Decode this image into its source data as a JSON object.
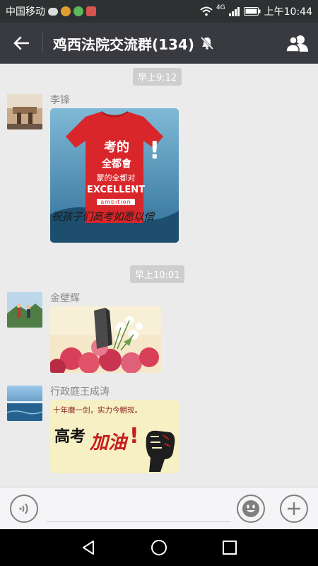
{
  "status_bar": {
    "carrier": "中国移动",
    "network": "4G",
    "time": "上午10:44"
  },
  "header": {
    "title": "鸡西法院交流群(134)",
    "back_icon": "arrow-left-icon",
    "mute_icon": "bell-muted-icon",
    "members_icon": "group-members-icon"
  },
  "messages": {
    "time1": "早上9:12",
    "time2": "早上10:01",
    "m1": {
      "sender": "李锋",
      "image": {
        "line1": "考的",
        "line2": "全都會",
        "line3": "蒙的全都对",
        "line4": "EXCELLENT",
        "line5": "ambition",
        "line6": "祝孩子们高考如愿以偿"
      }
    },
    "m2": {
      "sender": "金壁辉"
    },
    "m3": {
      "sender": "行政庭王成涛",
      "image": {
        "top": "十年磨一剑，实力今朝现。",
        "word1": "高考",
        "word2": "加油",
        "mark": "!"
      }
    }
  },
  "input_bar": {
    "voice_icon": "voice-icon",
    "emoji_icon": "emoji-icon",
    "plus_icon": "plus-icon"
  },
  "colors": {
    "title_bar": "#393a3f",
    "status_bar": "#2e3132",
    "chat_bg": "#ebebeb",
    "time_chip": "#cecece",
    "shirt_red": "#d8262a"
  }
}
